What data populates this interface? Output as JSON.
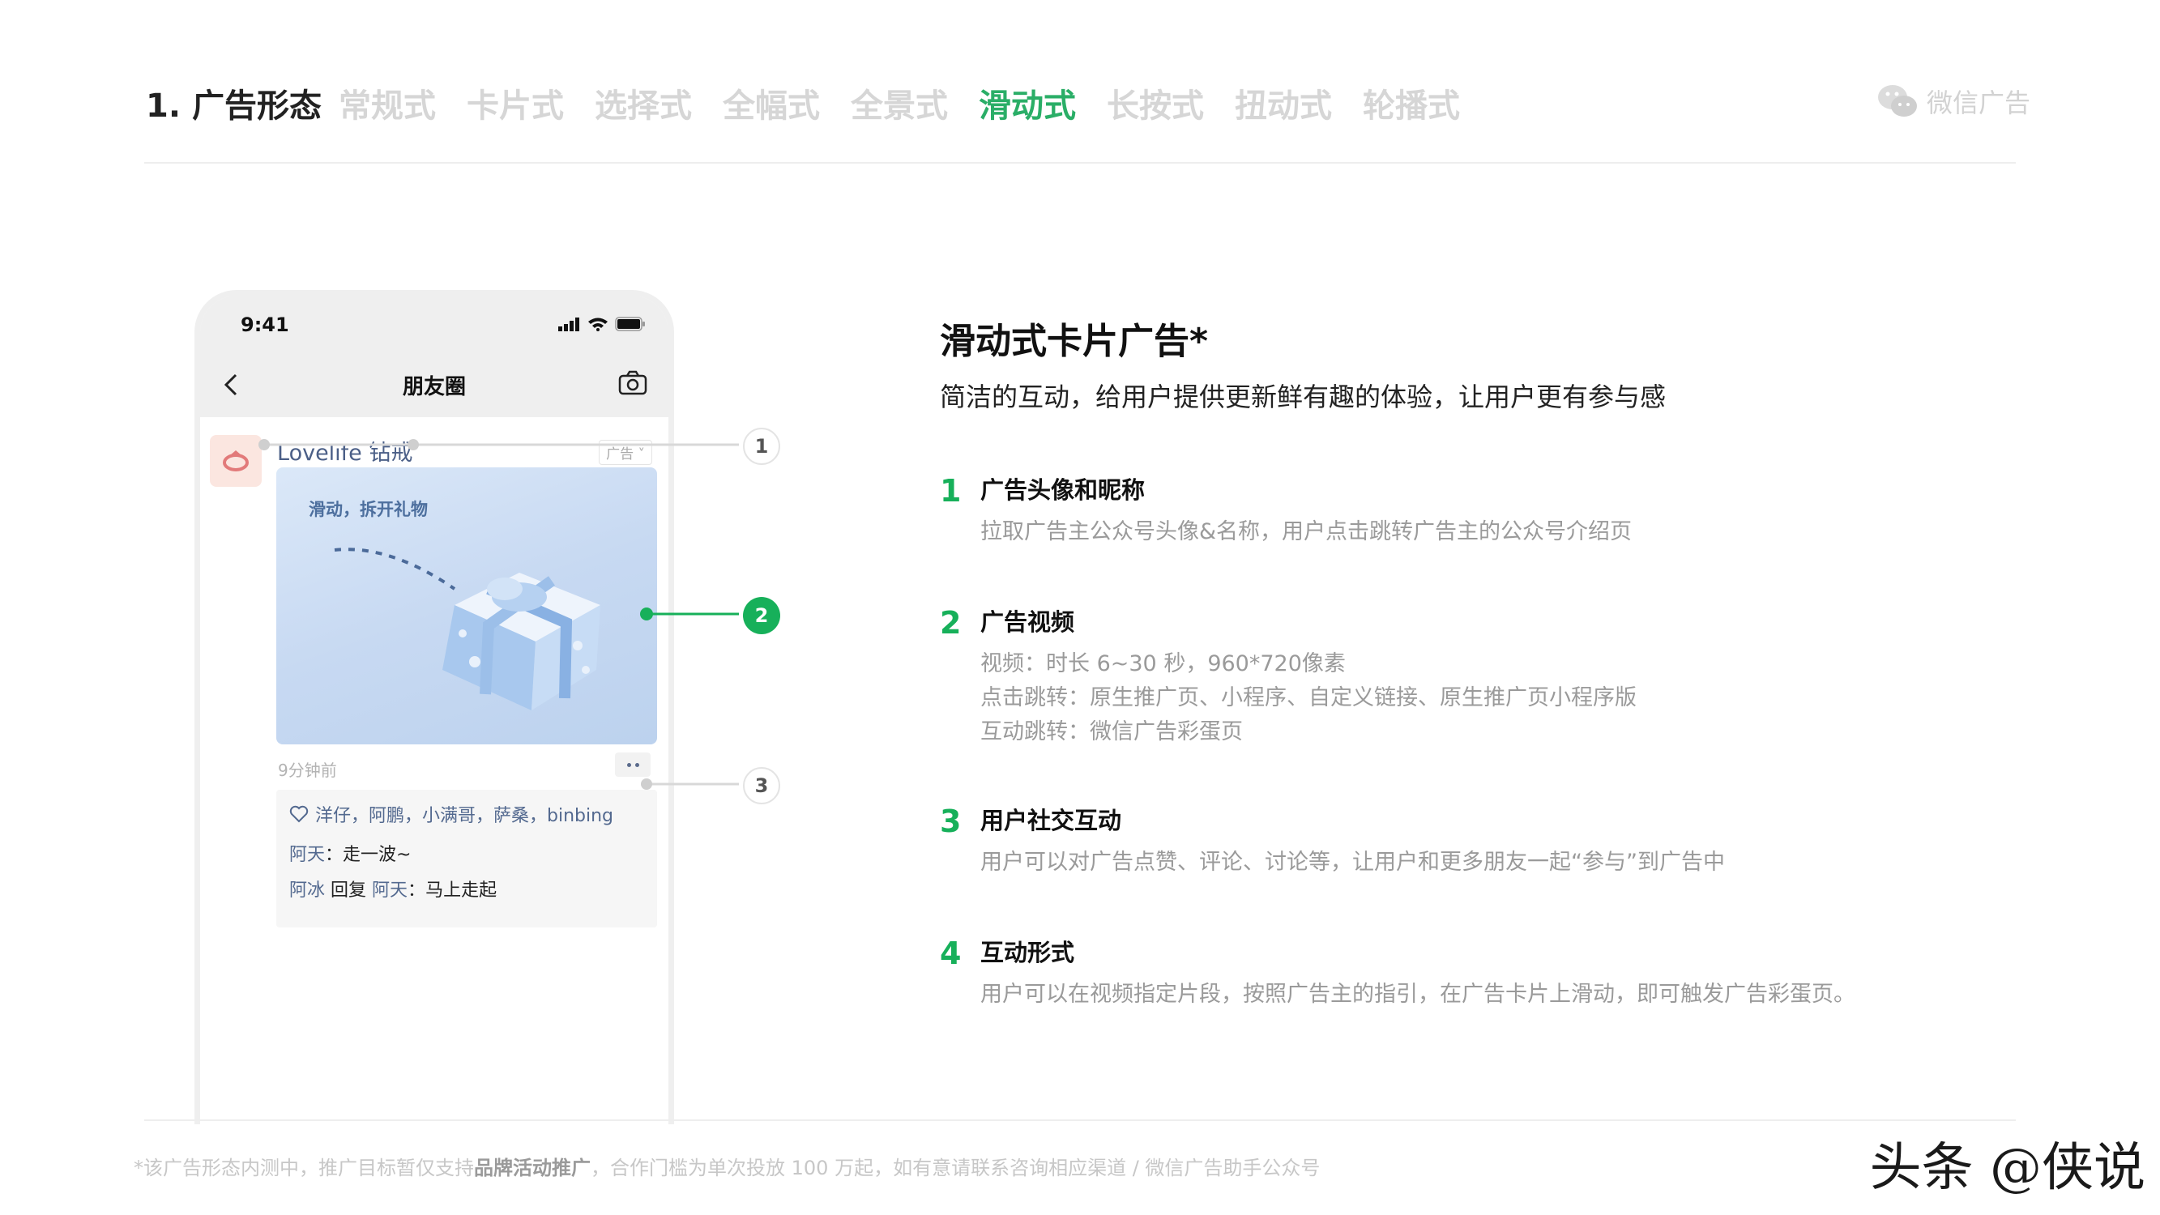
{
  "header": {
    "section_title": "1. 广告形态",
    "tabs": [
      {
        "label": "常规式",
        "active": false
      },
      {
        "label": "卡片式",
        "active": false
      },
      {
        "label": "选择式",
        "active": false
      },
      {
        "label": "全幅式",
        "active": false
      },
      {
        "label": "全景式",
        "active": false
      },
      {
        "label": "滑动式",
        "active": true
      },
      {
        "label": "长按式",
        "active": false
      },
      {
        "label": "扭动式",
        "active": false
      },
      {
        "label": "轮播式",
        "active": false
      }
    ],
    "brand_label": "微信广告",
    "active_color": "#2aae67",
    "inactive_color": "#d6d6d6"
  },
  "phone": {
    "status_time": "9:41",
    "nav_title": "朋友圈",
    "ad_name": "Lovelife 钻戒",
    "ad_tag": "广告",
    "ad_card_caption": "滑动，拆开礼物",
    "post_time": "9分钟前",
    "likes": "洋仔，阿鹏，小满哥，萨桑，binbing",
    "comments": [
      {
        "name": "阿天",
        "reply_to": "",
        "text": "走一波~"
      },
      {
        "name": "阿冰",
        "reply_to": "阿天",
        "reply_word": "回复",
        "text": "马上走起"
      }
    ]
  },
  "callouts": [
    "1",
    "2",
    "3"
  ],
  "content": {
    "title": "滑动式卡片广告*",
    "subtitle": "简洁的互动，给用户提供更新鲜有趣的体验，让用户更有参与感",
    "features": [
      {
        "num": "1",
        "title": "广告头像和昵称",
        "lines": [
          "拉取广告主公众号头像&名称，用户点击跳转广告主的公众号介绍页"
        ]
      },
      {
        "num": "2",
        "title": "广告视频",
        "lines": [
          "视频：时长 6~30 秒，960*720像素",
          "点击跳转：原生推广页、小程序、自定义链接、原生推广页小程序版",
          "互动跳转：微信广告彩蛋页"
        ]
      },
      {
        "num": "3",
        "title": "用户社交互动",
        "lines": [
          "用户可以对广告点赞、评论、讨论等，让用户和更多朋友一起“参与”到广告中"
        ]
      },
      {
        "num": "4",
        "title": "互动形式",
        "lines": [
          "用户可以在视频指定片段，按照广告主的指引，在广告卡片上滑动，即可触发广告彩蛋页。"
        ]
      }
    ],
    "accent_color": "#17b05a"
  },
  "footer": {
    "note_prefix": "*该广告形态内测中，推广目标暂仅支持",
    "note_bold": "品牌活动推广",
    "note_suffix": "，合作门槛为单次投放 100 万起，如有意请联系咨询相应渠道 / 微信广告助手公众号",
    "watermark": "头条 @侠说"
  }
}
